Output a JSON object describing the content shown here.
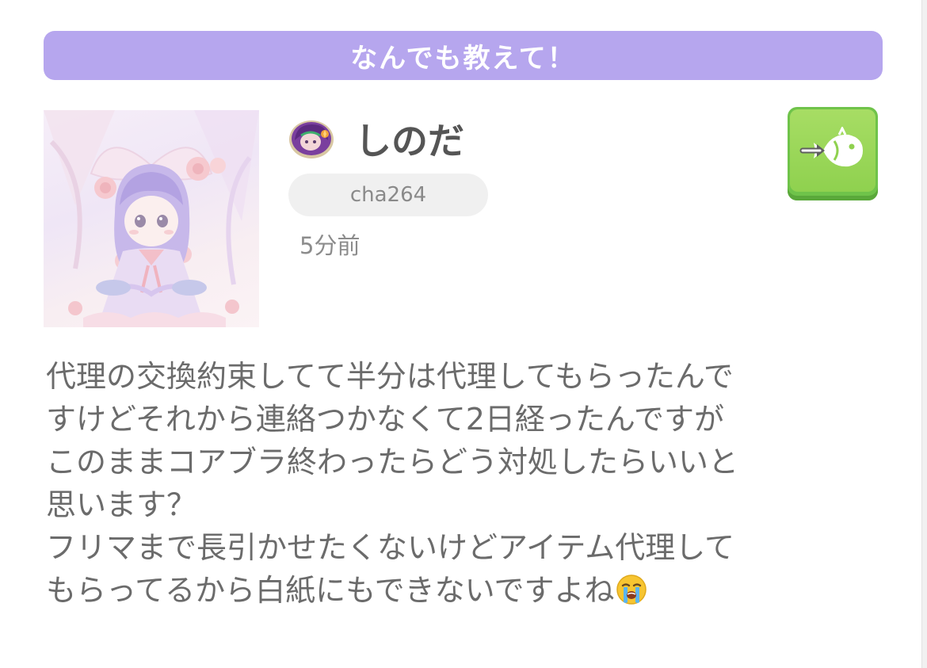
{
  "category": {
    "label": "なんでも教えて！",
    "color": "#b6a6ee"
  },
  "user": {
    "name": "しのだ",
    "id": "cha264",
    "posted_ago": "5分前",
    "avatar_icon": "avatar-doll-illustration",
    "badge_icon": "purple-hair-character-badge"
  },
  "actions": {
    "sticker_button_icon": "fish-arrow-icon",
    "sticker_button_color": "#8fd14f"
  },
  "post": {
    "lines": [
      "代理の交換約束してて半分は代理してもらったんで",
      "すけどそれから連絡つかなくて2日経ったんですが",
      "このままコアブラ終わったらどう対処したらいいと",
      "思います？",
      "フリマまで長引かせたくないけどアイテム代理して",
      "もらってるから白紙にもできないですよね"
    ],
    "trailing_emoji": "loudly-crying-face"
  }
}
